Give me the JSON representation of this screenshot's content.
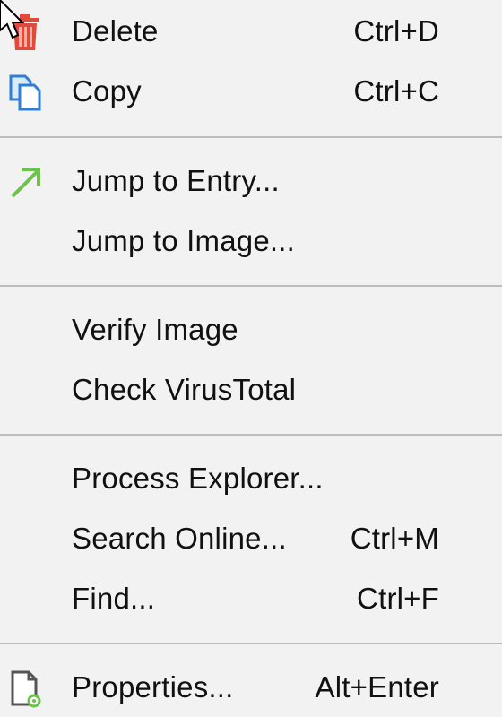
{
  "menu": {
    "items": [
      {
        "label": "Delete",
        "shortcut": "Ctrl+D",
        "icon": "trash-icon"
      },
      {
        "label": "Copy",
        "shortcut": "Ctrl+C",
        "icon": "copy-icon"
      },
      {
        "label": "Jump to Entry...",
        "shortcut": "",
        "icon": "arrow-up-right-icon"
      },
      {
        "label": "Jump to Image...",
        "shortcut": "",
        "icon": ""
      },
      {
        "label": "Verify Image",
        "shortcut": "",
        "icon": ""
      },
      {
        "label": "Check VirusTotal",
        "shortcut": "",
        "icon": ""
      },
      {
        "label": "Process Explorer...",
        "shortcut": "",
        "icon": ""
      },
      {
        "label": "Search Online...",
        "shortcut": "Ctrl+M",
        "icon": ""
      },
      {
        "label": "Find...",
        "shortcut": "Ctrl+F",
        "icon": ""
      },
      {
        "label": "Properties...",
        "shortcut": "Alt+Enter",
        "icon": "properties-icon"
      }
    ]
  },
  "colors": {
    "menu_background": "#f2f2f2",
    "separator": "#bdbdbd",
    "trash_red": "#e04a3a",
    "copy_blue": "#2f7fd8",
    "arrow_green": "#6cc24a"
  }
}
